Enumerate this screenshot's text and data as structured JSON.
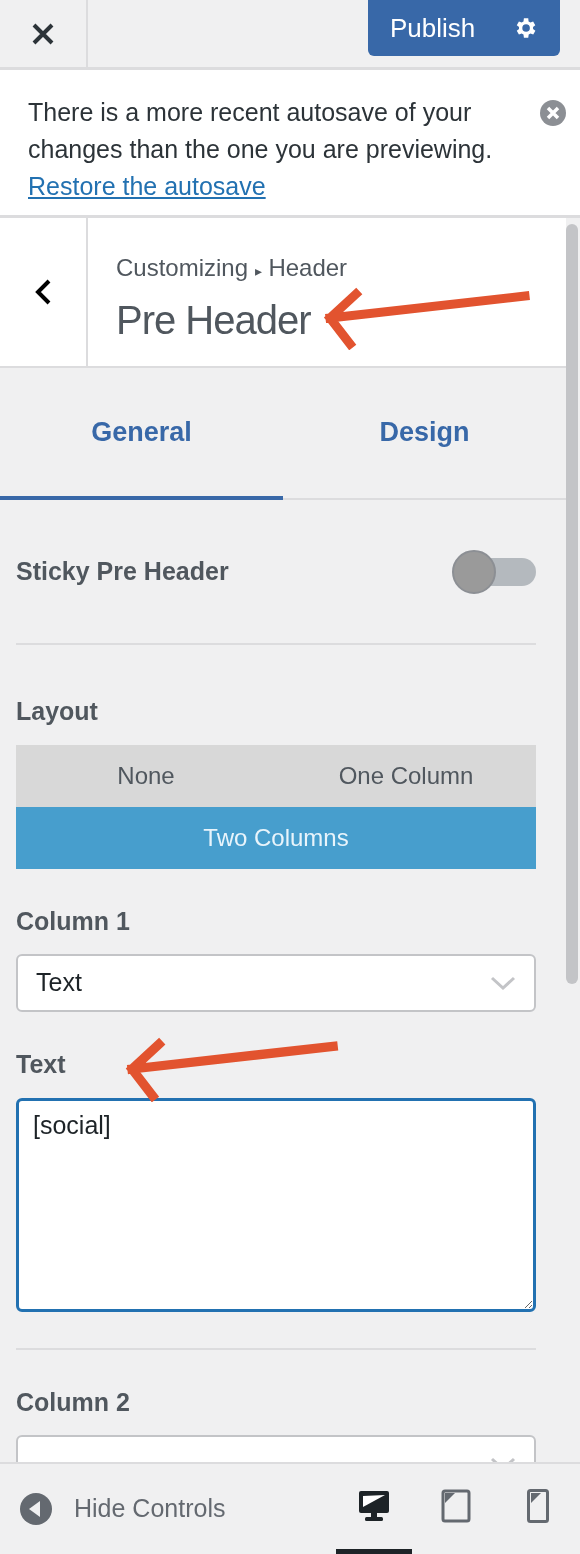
{
  "topbar": {
    "publish_label": "Publish"
  },
  "notice": {
    "text": "There is a more recent autosave of your changes than the one you are previewing.",
    "link": "Restore the autosave"
  },
  "section": {
    "breadcrumb": "Customizing",
    "parent": "Header",
    "separator": "▸",
    "title": "Pre Header"
  },
  "tabs": [
    {
      "label": "General",
      "selected": true
    },
    {
      "label": "Design",
      "selected": false
    }
  ],
  "controls": [
    {
      "kind": "toggle",
      "label": "Sticky Pre Header",
      "on": false
    },
    {
      "kind": "choices",
      "label": "Layout",
      "options": [
        {
          "label": "None",
          "selected": false
        },
        {
          "label": "One Column",
          "selected": false
        },
        {
          "label": "Two Columns",
          "selected": true
        }
      ]
    },
    {
      "kind": "select",
      "label": "Column 1",
      "value": "Text"
    },
    {
      "kind": "textarea",
      "label": "Text",
      "value": "[social]"
    },
    {
      "kind": "select",
      "label": "Column 2"
    }
  ],
  "footer": {
    "hide_label": "Hide Controls",
    "devices": [
      {
        "kind": "desktop",
        "selected": true
      },
      {
        "kind": "tablet",
        "selected": false
      },
      {
        "kind": "mobile",
        "selected": false
      }
    ]
  }
}
